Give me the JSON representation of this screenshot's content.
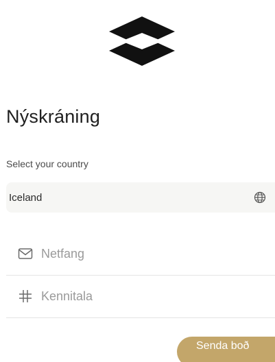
{
  "header": {
    "title": "Nýskráning"
  },
  "country": {
    "label": "Select your country",
    "selected": "Iceland",
    "icon": "globe-icon"
  },
  "form": {
    "email": {
      "placeholder": "Netfang",
      "value": "",
      "icon": "mail-icon"
    },
    "kennitala": {
      "placeholder": "Kennitala",
      "value": "",
      "icon": "hash-icon"
    },
    "submit_label": "Senda boð"
  },
  "colors": {
    "accent": "#c3a66a",
    "logo": "#111111",
    "field_bg": "#f6f6f4",
    "divider": "#e4e4e4"
  }
}
